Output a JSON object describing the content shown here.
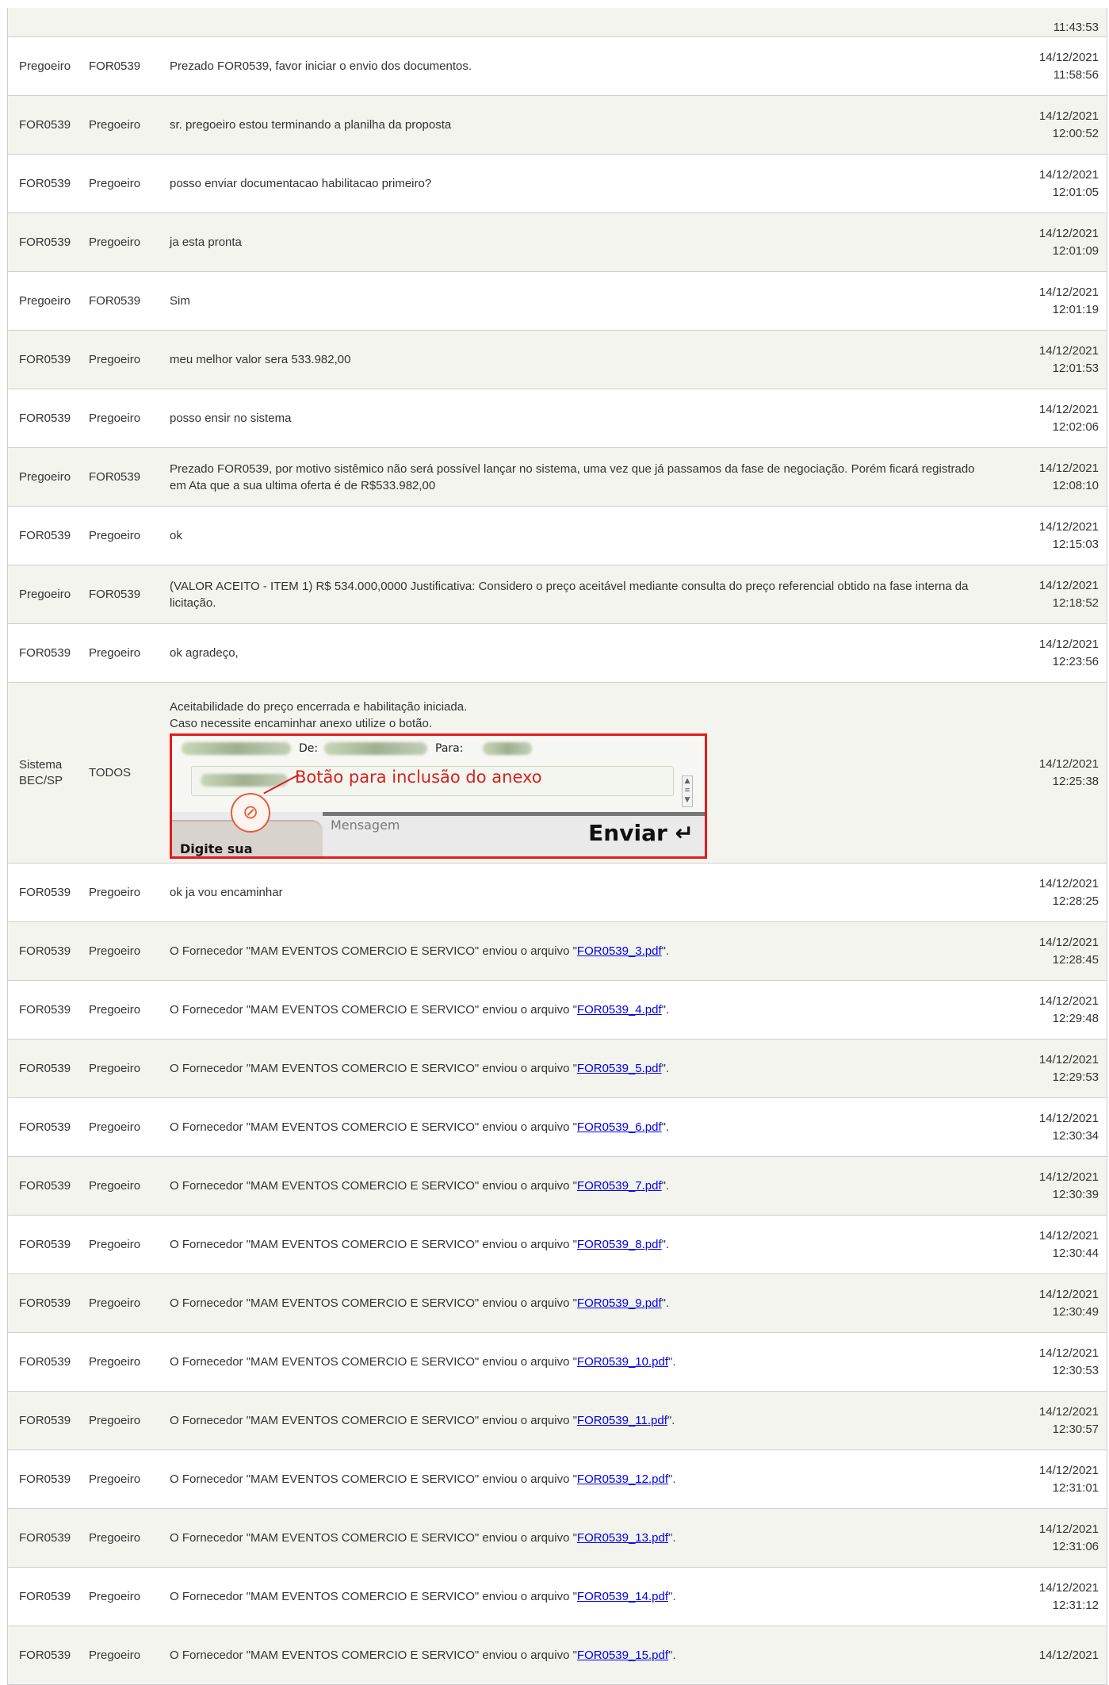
{
  "rows": [
    {
      "from": "",
      "to": "",
      "message": "",
      "date": "",
      "time": "11:43:53"
    },
    {
      "from": "Pregoeiro",
      "to": "FOR0539",
      "message": "Prezado FOR0539, favor iniciar o envio dos documentos.",
      "date": "14/12/2021",
      "time": "11:58:56"
    },
    {
      "from": "FOR0539",
      "to": "Pregoeiro",
      "message": "sr. pregoeiro estou terminando a planilha da proposta",
      "date": "14/12/2021",
      "time": "12:00:52"
    },
    {
      "from": "FOR0539",
      "to": "Pregoeiro",
      "message": "posso enviar documentacao habilitacao primeiro?",
      "date": "14/12/2021",
      "time": "12:01:05"
    },
    {
      "from": "FOR0539",
      "to": "Pregoeiro",
      "message": "ja esta pronta",
      "date": "14/12/2021",
      "time": "12:01:09"
    },
    {
      "from": "Pregoeiro",
      "to": "FOR0539",
      "message": "Sim",
      "date": "14/12/2021",
      "time": "12:01:19"
    },
    {
      "from": "FOR0539",
      "to": "Pregoeiro",
      "message": "meu melhor valor sera 533.982,00",
      "date": "14/12/2021",
      "time": "12:01:53"
    },
    {
      "from": "FOR0539",
      "to": "Pregoeiro",
      "message": "posso ensir no sistema",
      "date": "14/12/2021",
      "time": "12:02:06"
    },
    {
      "from": "Pregoeiro",
      "to": "FOR0539",
      "message": "Prezado FOR0539, por motivo sistêmico não será possível lançar no sistema, uma vez que já passamos da fase de negociação. Porém ficará registrado em Ata que a sua ultima oferta é de R$533.982,00",
      "date": "14/12/2021",
      "time": "12:08:10"
    },
    {
      "from": "FOR0539",
      "to": "Pregoeiro",
      "message": "ok",
      "date": "14/12/2021",
      "time": "12:15:03"
    },
    {
      "from": "Pregoeiro",
      "to": "FOR0539",
      "message": "(VALOR ACEITO - ITEM 1) R$ 534.000,0000 Justificativa: Considero o preço aceitável mediante consulta do preço referencial obtido na fase interna da licitação.",
      "date": "14/12/2021",
      "time": "12:18:52"
    },
    {
      "from": "FOR0539",
      "to": "Pregoeiro",
      "message": "ok agradeço,",
      "date": "14/12/2021",
      "time": "12:23:56"
    }
  ],
  "system_row": {
    "from": "Sistema BEC/SP",
    "to": "TODOS",
    "line1": "Aceitabilidade do preço encerrada e habilitação iniciada.",
    "line2": "Caso necessite encaminhar anexo utilize o botão.",
    "date": "14/12/2021",
    "time": "12:25:38",
    "help_image": {
      "de_label": "De:",
      "para_label": "Para:",
      "hint": "Botão para inclusão do anexo",
      "tab_label": "Digite sua mensagem",
      "message_placeholder": "Mensagem",
      "send_label": "Enviar ↵",
      "clip_icon": "paperclip-icon"
    }
  },
  "after_rows": [
    {
      "from": "FOR0539",
      "to": "Pregoeiro",
      "message": "ok ja vou encaminhar",
      "date": "14/12/2021",
      "time": "12:28:25"
    }
  ],
  "file_prefix": "O Fornecedor \"MAM EVENTOS COMERCIO E SERVICO\" enviou o arquivo \"",
  "file_suffix": "\".",
  "file_rows": [
    {
      "from": "FOR0539",
      "to": "Pregoeiro",
      "file": "FOR0539_3.pdf",
      "date": "14/12/2021",
      "time": "12:28:45"
    },
    {
      "from": "FOR0539",
      "to": "Pregoeiro",
      "file": "FOR0539_4.pdf",
      "date": "14/12/2021",
      "time": "12:29:48"
    },
    {
      "from": "FOR0539",
      "to": "Pregoeiro",
      "file": "FOR0539_5.pdf",
      "date": "14/12/2021",
      "time": "12:29:53"
    },
    {
      "from": "FOR0539",
      "to": "Pregoeiro",
      "file": "FOR0539_6.pdf",
      "date": "14/12/2021",
      "time": "12:30:34"
    },
    {
      "from": "FOR0539",
      "to": "Pregoeiro",
      "file": "FOR0539_7.pdf",
      "date": "14/12/2021",
      "time": "12:30:39"
    },
    {
      "from": "FOR0539",
      "to": "Pregoeiro",
      "file": "FOR0539_8.pdf",
      "date": "14/12/2021",
      "time": "12:30:44"
    },
    {
      "from": "FOR0539",
      "to": "Pregoeiro",
      "file": "FOR0539_9.pdf",
      "date": "14/12/2021",
      "time": "12:30:49"
    },
    {
      "from": "FOR0539",
      "to": "Pregoeiro",
      "file": "FOR0539_10.pdf",
      "date": "14/12/2021",
      "time": "12:30:53"
    },
    {
      "from": "FOR0539",
      "to": "Pregoeiro",
      "file": "FOR0539_11.pdf",
      "date": "14/12/2021",
      "time": "12:30:57"
    },
    {
      "from": "FOR0539",
      "to": "Pregoeiro",
      "file": "FOR0539_12.pdf",
      "date": "14/12/2021",
      "time": "12:31:01"
    },
    {
      "from": "FOR0539",
      "to": "Pregoeiro",
      "file": "FOR0539_13.pdf",
      "date": "14/12/2021",
      "time": "12:31:06"
    },
    {
      "from": "FOR0539",
      "to": "Pregoeiro",
      "file": "FOR0539_14.pdf",
      "date": "14/12/2021",
      "time": "12:31:12"
    },
    {
      "from": "FOR0539",
      "to": "Pregoeiro",
      "file": "FOR0539_15.pdf",
      "date": "14/12/2021",
      "time": ""
    }
  ]
}
